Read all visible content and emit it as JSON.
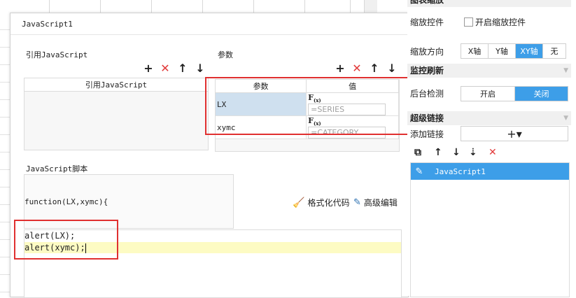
{
  "dialog": {
    "title": "JavaScript1",
    "ref_section_label": "引用JavaScript",
    "ref_table_header": "引用JavaScript",
    "param_section_label": "参数",
    "param_table": {
      "headers": [
        "参数",
        "值"
      ],
      "rows": [
        {
          "name": "LX",
          "value": "=SERIES"
        },
        {
          "name": "xymc",
          "value": "=CATEGORY"
        }
      ],
      "fx_label": "F(x)"
    },
    "script_section_label": "JavaScript脚本",
    "function_signature": "function(LX,xymc){",
    "format_button": "格式化代码",
    "advanced_button": "高级编辑",
    "code_lines": [
      "alert(LX);",
      "alert(xymc);"
    ]
  },
  "right_panel": {
    "header_zoom": "图表缩放",
    "zoom_control_label": "缩放控件",
    "zoom_enable_label": "开启缩放控件",
    "zoom_direction_label": "缩放方向",
    "zoom_direction_options": [
      "X轴",
      "Y轴",
      "XY轴",
      "无"
    ],
    "zoom_direction_selected": "XY轴",
    "header_monitor": "监控刷新",
    "bg_detect_label": "后台检测",
    "bg_detect_options": [
      "开启",
      "关闭"
    ],
    "bg_detect_selected": "关闭",
    "header_hyperlink": "超级链接",
    "add_link_label": "添加链接",
    "add_symbol": "+▾",
    "link_items": [
      "JavaScript1"
    ]
  },
  "colors": {
    "accent": "#3d9ee8",
    "delete_red": "#e23a3a",
    "highlight_box": "#e03030",
    "code_highlight": "#fdfbc3",
    "selected_cell": "#cfe0ef"
  }
}
